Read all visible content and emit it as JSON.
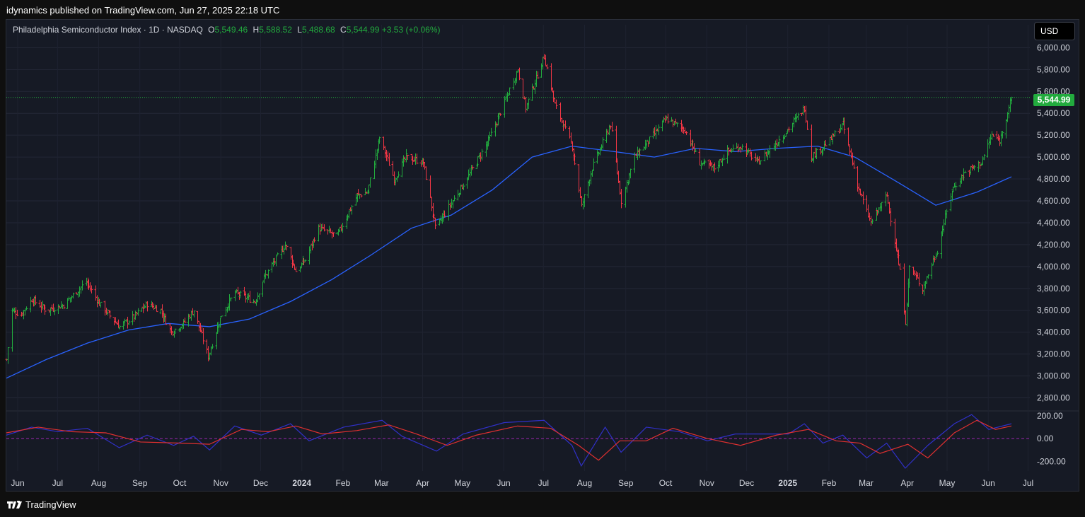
{
  "header": {
    "published": "idynamics published on TradingView.com, Jun 27, 2025 22:18 UTC"
  },
  "legend": {
    "title": "Philadelphia Semiconductor Index · 1D · NASDAQ",
    "o_label": "O",
    "o_value": "5,549.46",
    "h_label": "H",
    "h_value": "5,588.52",
    "l_label": "L",
    "l_value": "5,488.68",
    "c_label": "C",
    "c_value": "5,544.99",
    "change": "+3.53 (+0.06%)"
  },
  "currency_button": "USD",
  "last_price_label": "5,544.99",
  "footer": {
    "brand": "TradingView"
  },
  "colors": {
    "up": "#22ab3e",
    "down": "#f23645",
    "ma": "#2962ff",
    "osc_fast": "#3030c8",
    "osc_slow": "#e03030",
    "bg": "#161a25"
  },
  "chart_data": [
    {
      "type": "ohlc",
      "symbol": "Philadelphia Semiconductor Index",
      "interval": "1D",
      "exchange": "NASDAQ",
      "price_axis_ticks": [
        "6,000.00",
        "5,800.00",
        "5,600.00",
        "5,400.00",
        "5,200.00",
        "5,000.00",
        "4,800.00",
        "4,600.00",
        "4,400.00",
        "4,200.00",
        "4,000.00",
        "3,800.00",
        "3,600.00",
        "3,400.00",
        "3,200.00",
        "3,000.00",
        "2,800.00"
      ],
      "ylim": [
        2700,
        6080
      ],
      "time_axis_ticks": [
        "Jun",
        "Jul",
        "Aug",
        "Sep",
        "Oct",
        "Nov",
        "Dec",
        "2024",
        "Feb",
        "Mar",
        "Apr",
        "May",
        "Jun",
        "Jul",
        "Aug",
        "Sep",
        "Oct",
        "Nov",
        "Dec",
        "2025",
        "Feb",
        "Mar",
        "Apr",
        "May",
        "Jun",
        "Jul"
      ],
      "last_close": 5544.99,
      "price_path": [
        [
          "2023-06-01",
          3150
        ],
        [
          "2023-06-05",
          3600
        ],
        [
          "2023-06-12",
          3560
        ],
        [
          "2023-06-20",
          3700
        ],
        [
          "2023-07-01",
          3600
        ],
        [
          "2023-07-14",
          3650
        ],
        [
          "2023-07-31",
          3860
        ],
        [
          "2023-08-10",
          3660
        ],
        [
          "2023-08-25",
          3450
        ],
        [
          "2023-09-05",
          3540
        ],
        [
          "2023-09-15",
          3660
        ],
        [
          "2023-09-25",
          3600
        ],
        [
          "2023-10-03",
          3400
        ],
        [
          "2023-10-12",
          3480
        ],
        [
          "2023-10-20",
          3600
        ],
        [
          "2023-10-31",
          3180
        ],
        [
          "2023-11-10",
          3560
        ],
        [
          "2023-11-20",
          3760
        ],
        [
          "2023-12-05",
          3680
        ],
        [
          "2023-12-12",
          3900
        ],
        [
          "2023-12-28",
          4200
        ],
        [
          "2024-01-05",
          3960
        ],
        [
          "2024-01-12",
          4060
        ],
        [
          "2024-01-22",
          4350
        ],
        [
          "2024-02-05",
          4280
        ],
        [
          "2024-02-20",
          4650
        ],
        [
          "2024-02-28",
          4680
        ],
        [
          "2024-03-08",
          5180
        ],
        [
          "2024-03-19",
          4800
        ],
        [
          "2024-03-28",
          5000
        ],
        [
          "2024-04-10",
          4950
        ],
        [
          "2024-04-19",
          4350
        ],
        [
          "2024-05-01",
          4580
        ],
        [
          "2024-05-15",
          4850
        ],
        [
          "2024-05-29",
          5150
        ],
        [
          "2024-06-10",
          5500
        ],
        [
          "2024-06-20",
          5800
        ],
        [
          "2024-06-26",
          5450
        ],
        [
          "2024-07-10",
          5920
        ],
        [
          "2024-07-18",
          5480
        ],
        [
          "2024-07-31",
          5100
        ],
        [
          "2024-08-07",
          4550
        ],
        [
          "2024-08-15",
          4900
        ],
        [
          "2024-08-29",
          5300
        ],
        [
          "2024-09-06",
          4600
        ],
        [
          "2024-09-16",
          5000
        ],
        [
          "2024-09-30",
          5200
        ],
        [
          "2024-10-10",
          5350
        ],
        [
          "2024-10-24",
          5250
        ],
        [
          "2024-11-04",
          4950
        ],
        [
          "2024-11-15",
          4900
        ],
        [
          "2024-11-25",
          5050
        ],
        [
          "2024-12-05",
          5100
        ],
        [
          "2024-12-18",
          4950
        ],
        [
          "2025-01-06",
          5200
        ],
        [
          "2025-01-22",
          5450
        ],
        [
          "2025-01-27",
          5000
        ],
        [
          "2025-02-10",
          5150
        ],
        [
          "2025-02-20",
          5300
        ],
        [
          "2025-03-04",
          4700
        ],
        [
          "2025-03-13",
          4400
        ],
        [
          "2025-03-25",
          4650
        ],
        [
          "2025-04-04",
          3950
        ],
        [
          "2025-04-08",
          3500
        ],
        [
          "2025-04-11",
          4000
        ],
        [
          "2025-04-21",
          3800
        ],
        [
          "2025-05-02",
          4150
        ],
        [
          "2025-05-13",
          4700
        ],
        [
          "2025-05-22",
          4850
        ],
        [
          "2025-06-04",
          4950
        ],
        [
          "2025-06-12",
          5200
        ],
        [
          "2025-06-18",
          5150
        ],
        [
          "2025-06-27",
          5545
        ]
      ],
      "moving_average_path": [
        [
          "2023-06-01",
          2980
        ],
        [
          "2023-07-01",
          3150
        ],
        [
          "2023-08-01",
          3300
        ],
        [
          "2023-09-01",
          3420
        ],
        [
          "2023-10-01",
          3480
        ],
        [
          "2023-11-01",
          3450
        ],
        [
          "2023-12-01",
          3520
        ],
        [
          "2024-01-01",
          3680
        ],
        [
          "2024-02-01",
          3880
        ],
        [
          "2024-03-01",
          4100
        ],
        [
          "2024-04-01",
          4350
        ],
        [
          "2024-05-01",
          4470
        ],
        [
          "2024-06-01",
          4700
        ],
        [
          "2024-07-01",
          5000
        ],
        [
          "2024-07-31",
          5100
        ],
        [
          "2024-09-01",
          5050
        ],
        [
          "2024-10-01",
          5000
        ],
        [
          "2024-11-01",
          5080
        ],
        [
          "2024-12-01",
          5050
        ],
        [
          "2025-01-01",
          5080
        ],
        [
          "2025-02-01",
          5100
        ],
        [
          "2025-03-01",
          5000
        ],
        [
          "2025-04-01",
          4780
        ],
        [
          "2025-05-01",
          4560
        ],
        [
          "2025-06-01",
          4680
        ],
        [
          "2025-06-27",
          4820
        ]
      ]
    },
    {
      "type": "line",
      "panel": "oscillator",
      "axis_ticks": [
        "200.00",
        "0.00",
        "-200.00"
      ],
      "ylim": [
        -260,
        230
      ],
      "series": [
        {
          "role": "fast",
          "color": "#3030c8",
          "points": [
            [
              "2023-06-01",
              30
            ],
            [
              "2023-06-20",
              100
            ],
            [
              "2023-07-10",
              60
            ],
            [
              "2023-08-01",
              90
            ],
            [
              "2023-08-25",
              -80
            ],
            [
              "2023-09-15",
              30
            ],
            [
              "2023-10-05",
              -60
            ],
            [
              "2023-10-20",
              20
            ],
            [
              "2023-11-01",
              -100
            ],
            [
              "2023-11-20",
              110
            ],
            [
              "2023-12-10",
              30
            ],
            [
              "2024-01-01",
              130
            ],
            [
              "2024-01-15",
              -20
            ],
            [
              "2024-02-10",
              100
            ],
            [
              "2024-03-10",
              160
            ],
            [
              "2024-03-25",
              20
            ],
            [
              "2024-04-20",
              -110
            ],
            [
              "2024-05-10",
              40
            ],
            [
              "2024-06-10",
              140
            ],
            [
              "2024-07-10",
              160
            ],
            [
              "2024-07-31",
              -60
            ],
            [
              "2024-08-07",
              -240
            ],
            [
              "2024-08-25",
              100
            ],
            [
              "2024-09-06",
              -120
            ],
            [
              "2024-09-25",
              100
            ],
            [
              "2024-10-20",
              60
            ],
            [
              "2024-11-10",
              -20
            ],
            [
              "2024-12-01",
              40
            ],
            [
              "2025-01-10",
              40
            ],
            [
              "2025-01-22",
              130
            ],
            [
              "2025-02-05",
              -40
            ],
            [
              "2025-02-20",
              30
            ],
            [
              "2025-03-10",
              -170
            ],
            [
              "2025-03-25",
              -40
            ],
            [
              "2025-04-08",
              -260
            ],
            [
              "2025-04-25",
              -60
            ],
            [
              "2025-05-15",
              130
            ],
            [
              "2025-05-28",
              210
            ],
            [
              "2025-06-10",
              80
            ],
            [
              "2025-06-27",
              130
            ]
          ]
        },
        {
          "role": "slow",
          "color": "#e03030",
          "points": [
            [
              "2023-06-01",
              50
            ],
            [
              "2023-06-25",
              100
            ],
            [
              "2023-07-20",
              60
            ],
            [
              "2023-08-15",
              50
            ],
            [
              "2023-09-10",
              -30
            ],
            [
              "2023-10-10",
              -40
            ],
            [
              "2023-11-01",
              -50
            ],
            [
              "2023-11-25",
              80
            ],
            [
              "2023-12-15",
              60
            ],
            [
              "2024-01-05",
              110
            ],
            [
              "2024-01-25",
              40
            ],
            [
              "2024-02-20",
              70
            ],
            [
              "2024-03-15",
              120
            ],
            [
              "2024-04-05",
              40
            ],
            [
              "2024-04-28",
              -60
            ],
            [
              "2024-05-20",
              30
            ],
            [
              "2024-06-20",
              110
            ],
            [
              "2024-07-15",
              90
            ],
            [
              "2024-08-05",
              -60
            ],
            [
              "2024-08-20",
              -190
            ],
            [
              "2024-09-05",
              -20
            ],
            [
              "2024-09-25",
              -20
            ],
            [
              "2024-10-15",
              90
            ],
            [
              "2024-11-10",
              0
            ],
            [
              "2024-12-05",
              -60
            ],
            [
              "2025-01-01",
              30
            ],
            [
              "2025-01-25",
              80
            ],
            [
              "2025-02-15",
              -20
            ],
            [
              "2025-03-05",
              -40
            ],
            [
              "2025-03-20",
              -130
            ],
            [
              "2025-04-10",
              -50
            ],
            [
              "2025-04-25",
              -170
            ],
            [
              "2025-05-15",
              50
            ],
            [
              "2025-06-01",
              160
            ],
            [
              "2025-06-15",
              80
            ],
            [
              "2025-06-27",
              110
            ]
          ]
        }
      ]
    }
  ]
}
